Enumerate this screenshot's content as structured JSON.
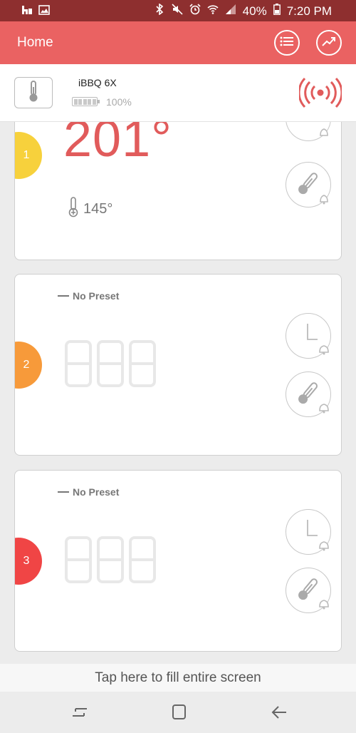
{
  "status_bar": {
    "battery_percent": "40%",
    "time": "7:20 PM",
    "left_icons": [
      "home-app-icon",
      "image-icon"
    ],
    "right_icons": [
      "bluetooth-icon",
      "mute-icon",
      "alarm-icon",
      "wifi-icon",
      "signal-icon",
      "battery-icon"
    ]
  },
  "app_bar": {
    "title": "Home",
    "actions": [
      "list-icon",
      "trend-chart-icon"
    ],
    "color": "#ea6262"
  },
  "device": {
    "name": "iBBQ 6X",
    "battery": "100%",
    "connected_icon": "broadcast-signal-icon",
    "accent": "#e15b5b"
  },
  "probes": [
    {
      "number": "1",
      "color": "#f7d13c",
      "current_temp": "201°",
      "target_temp": "145°"
    },
    {
      "number": "2",
      "color": "#f79a3a",
      "preset": "No Preset"
    },
    {
      "number": "3",
      "color": "#f04545",
      "preset": "No Preset"
    }
  ],
  "fill_screen": {
    "label": "Tap here to fill entire screen"
  },
  "nav_bar": {
    "buttons": [
      "recents-icon",
      "home-icon",
      "back-icon"
    ]
  }
}
